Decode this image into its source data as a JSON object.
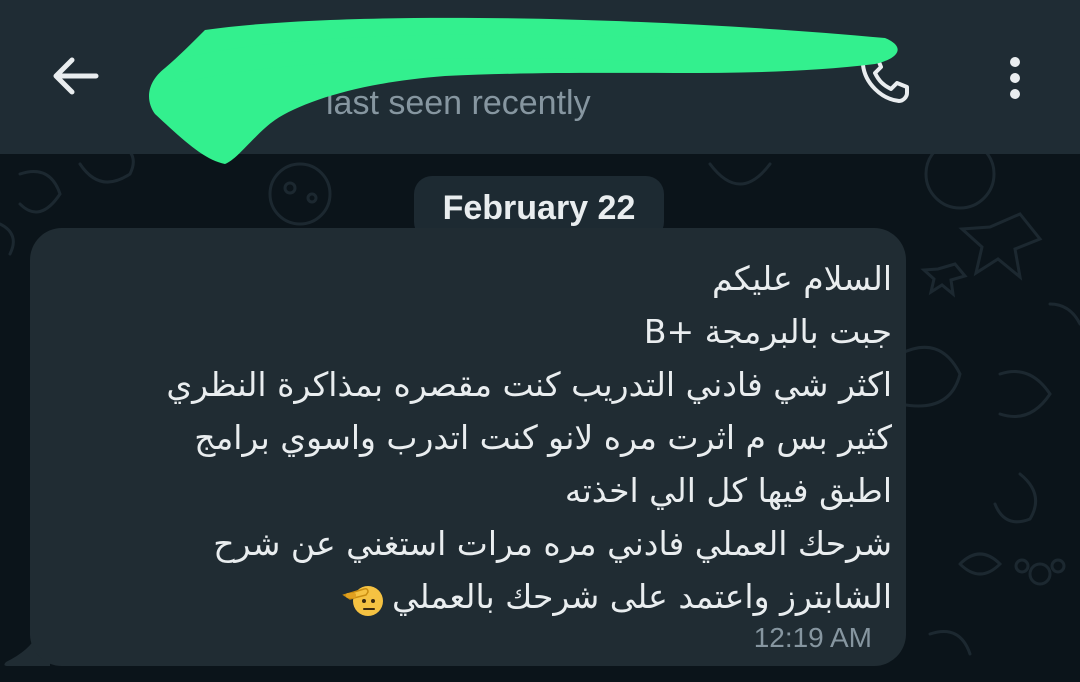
{
  "header": {
    "back_icon": "arrow-left-icon",
    "contact_name": "",
    "status": "last seen recently",
    "call_icon": "phone-icon",
    "menu_icon": "more-vertical-icon"
  },
  "chat": {
    "date_divider": "February 22",
    "messages": [
      {
        "lines": [
          "السلام عليكم",
          "جبت بالبرمجة +B",
          "اكثر شي فادني التدريب كنت مقصره بمذاكرة النظري",
          "كثير بس م اثرت مره لانو كنت اتدرب واسوي برامج",
          "اطبق فيها كل الي اخذته",
          "شرحك العملي فادني مره مرات استغني عن شرح",
          "الشابترز واعتمد على شرحك بالعملي"
        ],
        "emoji": "saluting-face-emoji",
        "time": "12:19 AM"
      }
    ]
  },
  "colors": {
    "header_bg": "#1f2c34",
    "chat_bg": "#0b141a",
    "bubble_bg": "#202c33",
    "redaction": "#33f08e"
  }
}
